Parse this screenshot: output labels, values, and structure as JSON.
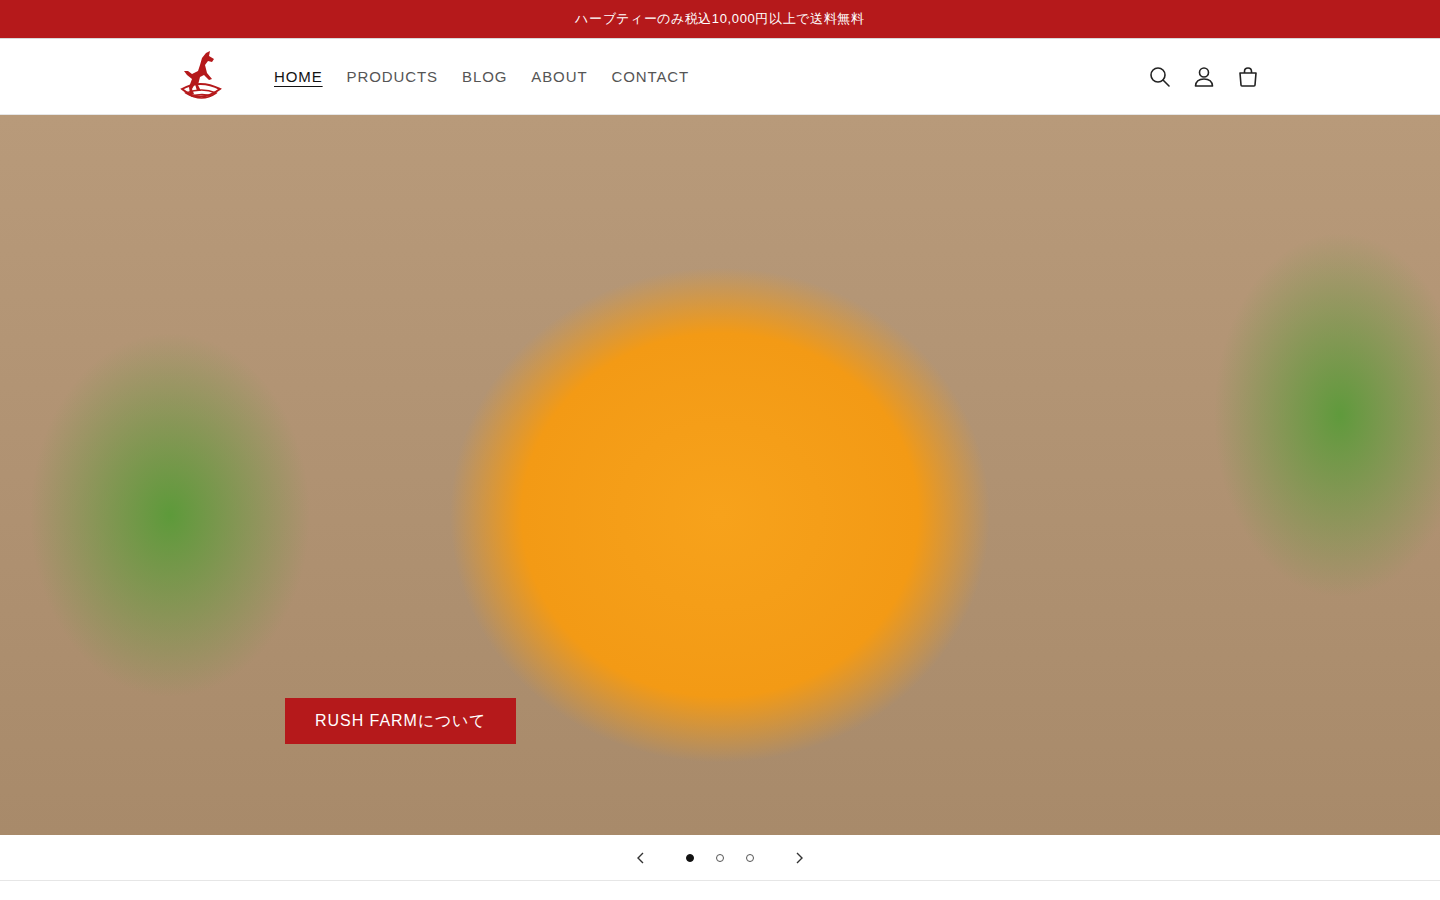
{
  "announcement": "ハーブティーのみ税込10,000円以上で送料無料",
  "nav": [
    {
      "label": "HOME",
      "selected": true
    },
    {
      "label": "PRODUCTS",
      "selected": false
    },
    {
      "label": "BLOG",
      "selected": false
    },
    {
      "label": "ABOUT",
      "selected": false
    },
    {
      "label": "CONTACT",
      "selected": false
    }
  ],
  "hero": {
    "button": "RUSH FARMについて"
  },
  "slider": {
    "dots": [
      {
        "selected": true
      },
      {
        "selected": false
      },
      {
        "selected": false
      }
    ]
  }
}
